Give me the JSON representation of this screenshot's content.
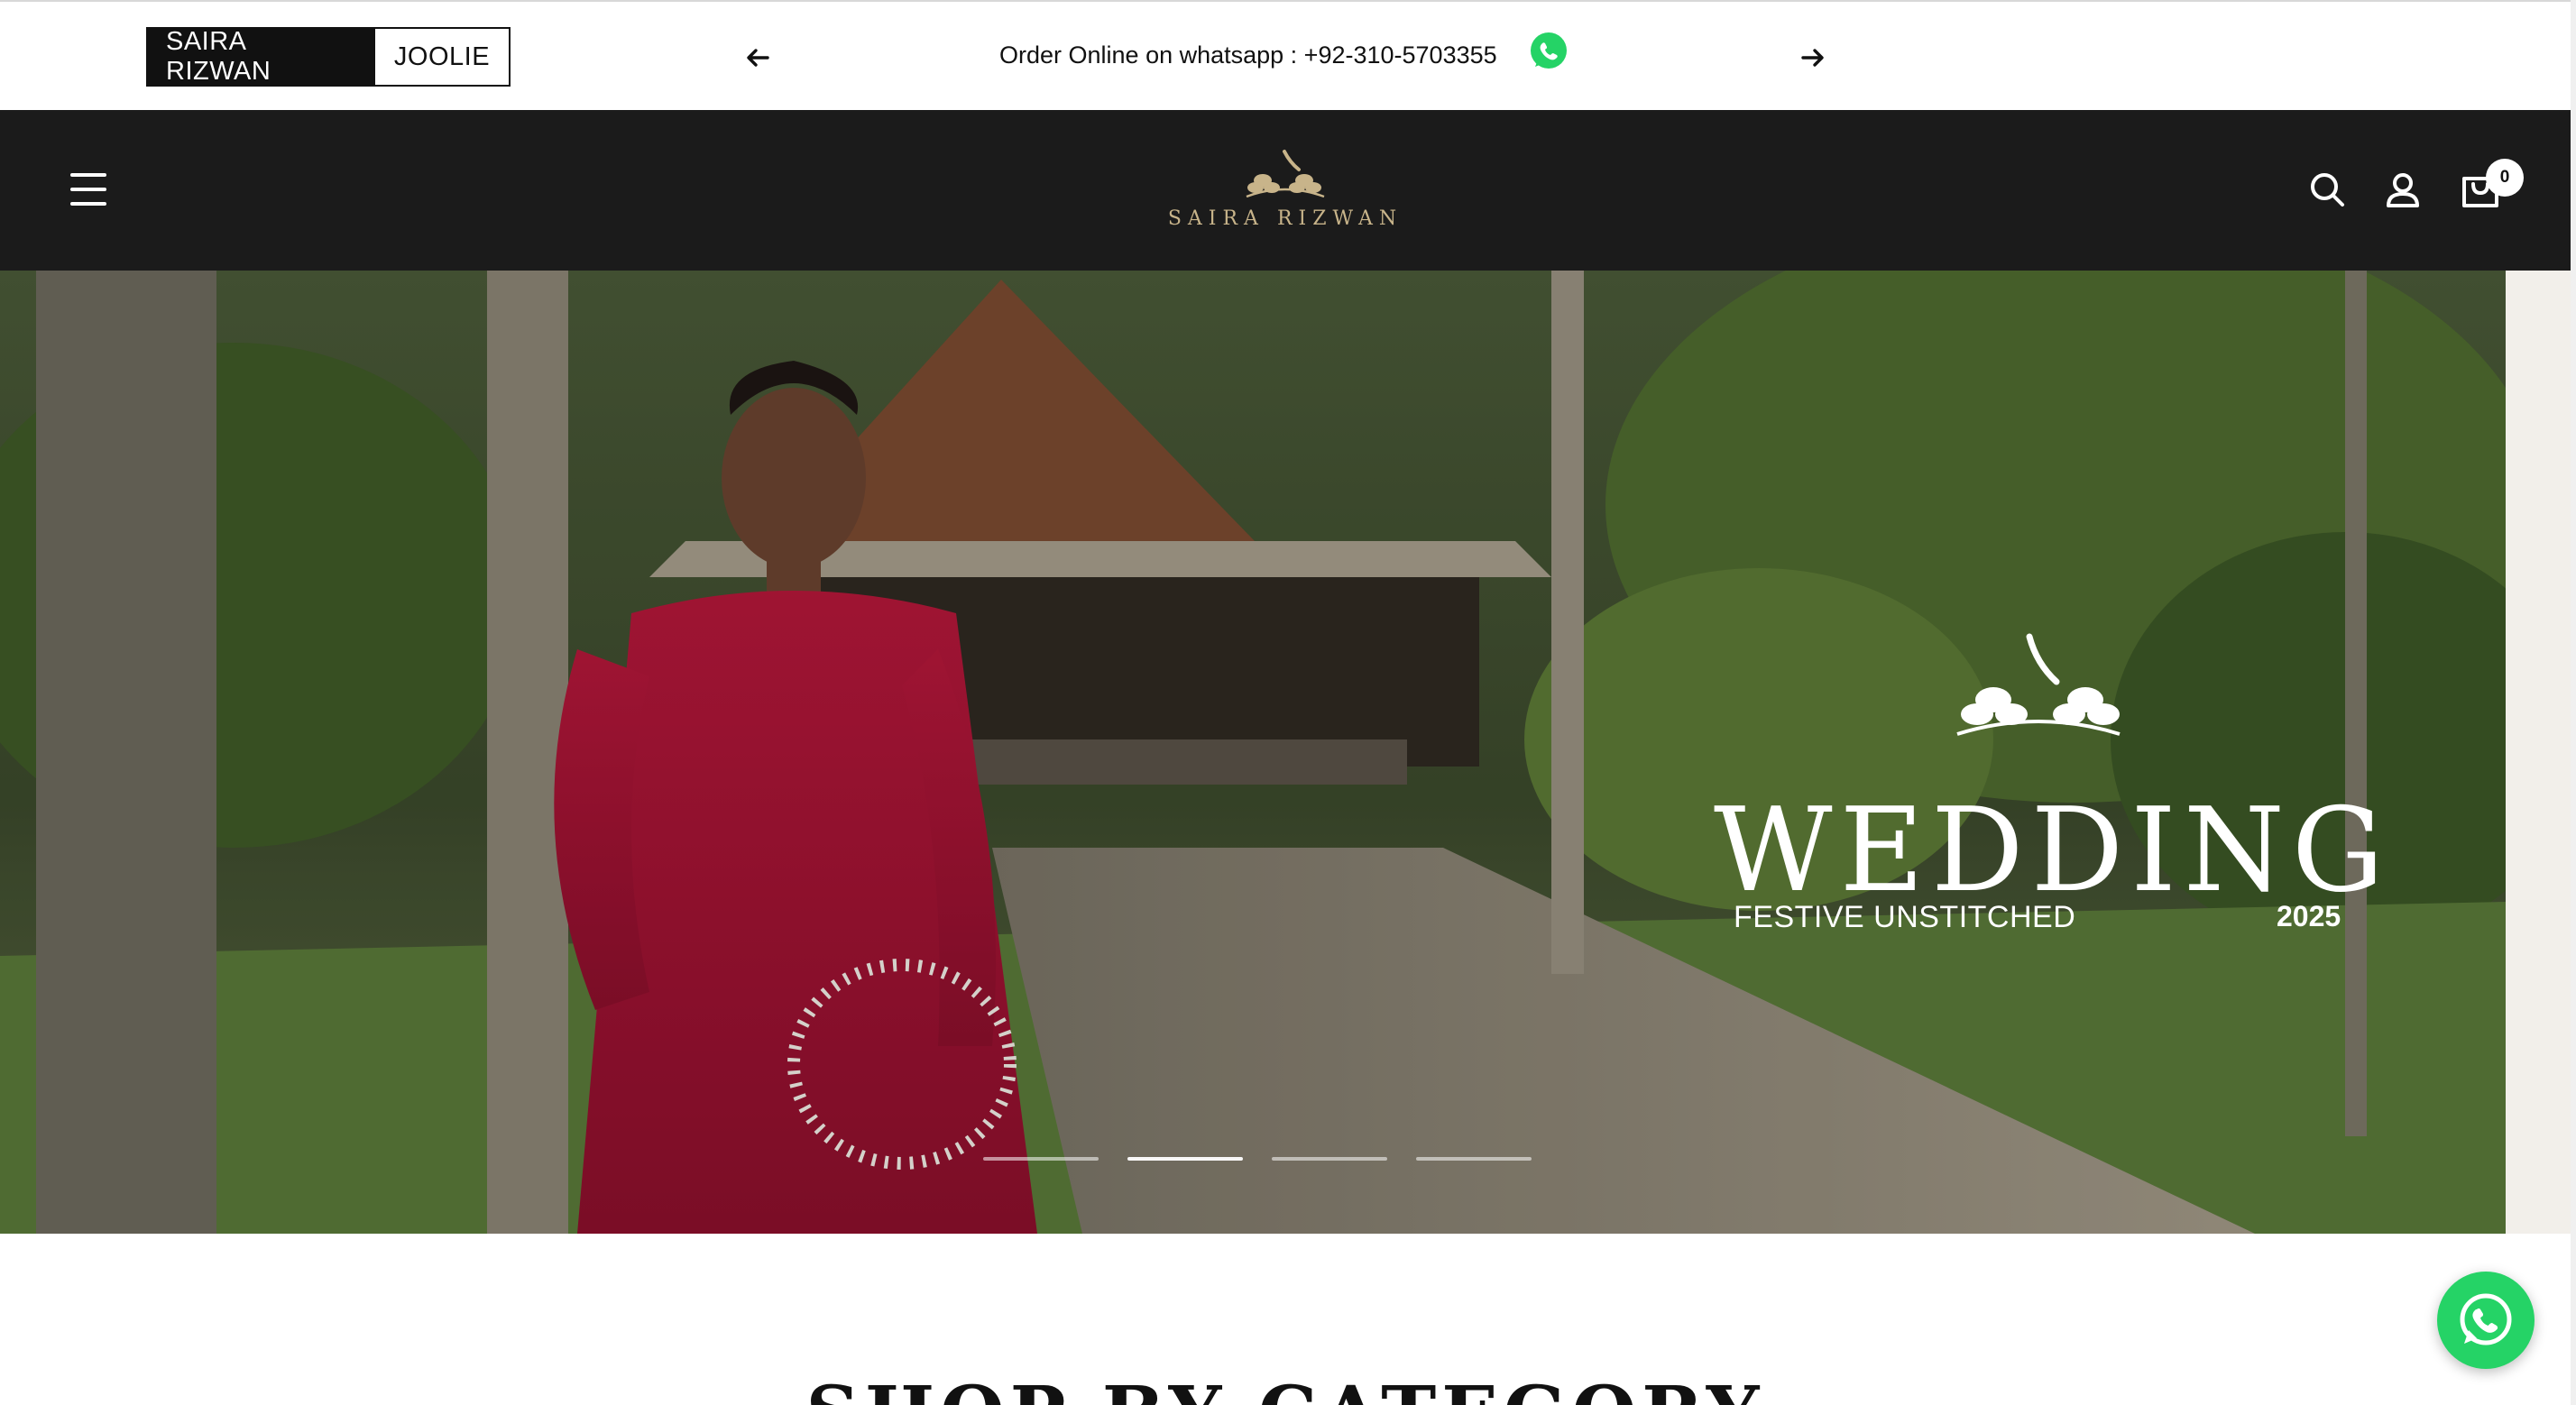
{
  "announcement": {
    "brands": [
      {
        "label": "SAIRA RIZWAN",
        "active": true
      },
      {
        "label": "JOOLIE",
        "active": false
      }
    ],
    "message": "Order Online on whatsapp : +92-310-5703355"
  },
  "header": {
    "logo_text": "SAIRA RIZWAN",
    "cart_count": "0"
  },
  "hero": {
    "title": "WEDDING",
    "subtitle": "FESTIVE UNSTITCHED",
    "year": "2025",
    "slides_total": 4,
    "active_slide": 2
  },
  "sections": {
    "category_title": "SHOP BY CATEGORY"
  },
  "colors": {
    "header_bg": "#1b1b1b",
    "logo_gold": "#c8b48a",
    "whatsapp_green": "#25d366"
  }
}
